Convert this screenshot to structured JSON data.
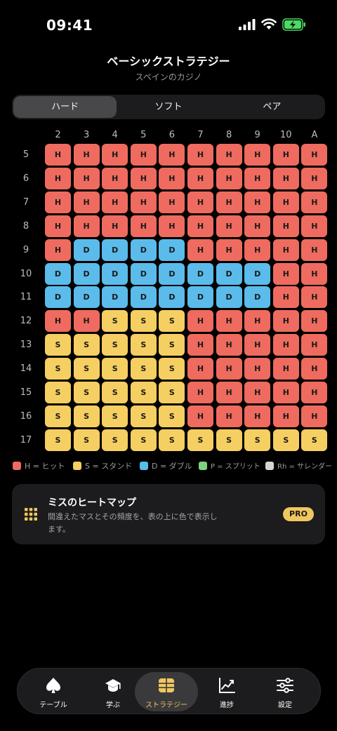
{
  "status_bar": {
    "time": "09:41"
  },
  "header": {
    "title": "ベーシックストラテジー",
    "subtitle": "スペインのカジノ"
  },
  "segments": [
    {
      "label": "ハード",
      "active": true
    },
    {
      "label": "ソフト",
      "active": false
    },
    {
      "label": "ペア",
      "active": false
    }
  ],
  "grid": {
    "columns": [
      "2",
      "3",
      "4",
      "5",
      "6",
      "7",
      "8",
      "9",
      "10",
      "A"
    ],
    "rows": [
      {
        "label": "5",
        "cells": [
          "H",
          "H",
          "H",
          "H",
          "H",
          "H",
          "H",
          "H",
          "H",
          "H"
        ]
      },
      {
        "label": "6",
        "cells": [
          "H",
          "H",
          "H",
          "H",
          "H",
          "H",
          "H",
          "H",
          "H",
          "H"
        ]
      },
      {
        "label": "7",
        "cells": [
          "H",
          "H",
          "H",
          "H",
          "H",
          "H",
          "H",
          "H",
          "H",
          "H"
        ]
      },
      {
        "label": "8",
        "cells": [
          "H",
          "H",
          "H",
          "H",
          "H",
          "H",
          "H",
          "H",
          "H",
          "H"
        ]
      },
      {
        "label": "9",
        "cells": [
          "H",
          "D",
          "D",
          "D",
          "D",
          "H",
          "H",
          "H",
          "H",
          "H"
        ]
      },
      {
        "label": "10",
        "cells": [
          "D",
          "D",
          "D",
          "D",
          "D",
          "D",
          "D",
          "D",
          "H",
          "H"
        ]
      },
      {
        "label": "11",
        "cells": [
          "D",
          "D",
          "D",
          "D",
          "D",
          "D",
          "D",
          "D",
          "H",
          "H"
        ]
      },
      {
        "label": "12",
        "cells": [
          "H",
          "H",
          "S",
          "S",
          "S",
          "H",
          "H",
          "H",
          "H",
          "H"
        ]
      },
      {
        "label": "13",
        "cells": [
          "S",
          "S",
          "S",
          "S",
          "S",
          "H",
          "H",
          "H",
          "H",
          "H"
        ]
      },
      {
        "label": "14",
        "cells": [
          "S",
          "S",
          "S",
          "S",
          "S",
          "H",
          "H",
          "H",
          "H",
          "H"
        ]
      },
      {
        "label": "15",
        "cells": [
          "S",
          "S",
          "S",
          "S",
          "S",
          "H",
          "H",
          "H",
          "H",
          "H"
        ]
      },
      {
        "label": "16",
        "cells": [
          "S",
          "S",
          "S",
          "S",
          "S",
          "H",
          "H",
          "H",
          "H",
          "H"
        ]
      },
      {
        "label": "17",
        "cells": [
          "S",
          "S",
          "S",
          "S",
          "S",
          "S",
          "S",
          "S",
          "S",
          "S"
        ]
      }
    ]
  },
  "colors": {
    "H": "#ef6b5f",
    "S": "#f5cf62",
    "D": "#5bbbea",
    "P": "#7fd17f",
    "Rh": "#d4d4d4",
    "accent": "#f0c75e"
  },
  "legend": [
    {
      "key": "H",
      "label": "H = ヒット"
    },
    {
      "key": "S",
      "label": "S = スタンド"
    },
    {
      "key": "D",
      "label": "D = ダブル"
    },
    {
      "key": "P",
      "label": "P = スプリット"
    },
    {
      "key": "Rh",
      "label": "Rh = サレンダー"
    }
  ],
  "heatmap_card": {
    "icon": "grid-icon",
    "title": "ミスのヒートマップ",
    "description": "間違えたマスとその頻度を、表の上に色で表示します。",
    "badge": "PRO"
  },
  "tabs": [
    {
      "label": "テーブル",
      "icon": "spade-icon",
      "active": false
    },
    {
      "label": "学ぶ",
      "icon": "graduation-cap-icon",
      "active": false
    },
    {
      "label": "ストラテジー",
      "icon": "table-icon",
      "active": true
    },
    {
      "label": "進捗",
      "icon": "chart-line-icon",
      "active": false
    },
    {
      "label": "設定",
      "icon": "sliders-icon",
      "active": false
    }
  ]
}
